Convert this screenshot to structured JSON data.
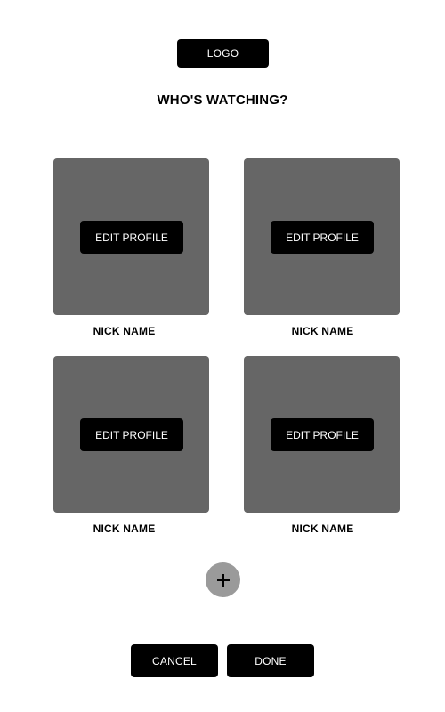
{
  "header": {
    "logo_label": "LOGO",
    "title": "WHO'S WATCHING?"
  },
  "profiles": [
    {
      "edit_label": "EDIT PROFILE",
      "name": "NICK NAME"
    },
    {
      "edit_label": "EDIT PROFILE",
      "name": "NICK NAME"
    },
    {
      "edit_label": "EDIT PROFILE",
      "name": "NICK NAME"
    },
    {
      "edit_label": "EDIT PROFILE",
      "name": "NICK NAME"
    }
  ],
  "add_profile": {
    "icon": "plus-icon"
  },
  "footer": {
    "cancel_label": "CANCEL",
    "done_label": "DONE"
  },
  "colors": {
    "card_background": "#666666",
    "button_background": "#000000",
    "add_button_background": "#9a9a9a"
  }
}
